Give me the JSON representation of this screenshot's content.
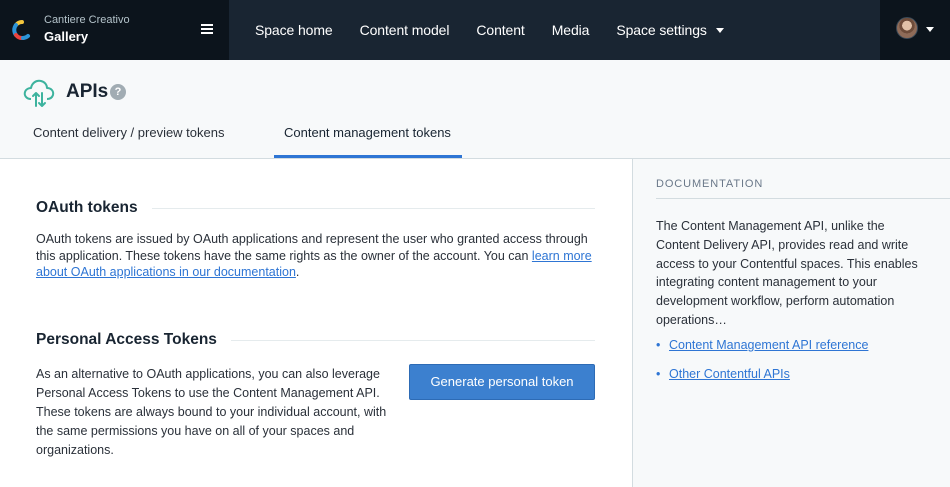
{
  "topbar": {
    "space_org": "Cantiere Creativo",
    "space_name": "Gallery",
    "nav": [
      {
        "label": "Space home"
      },
      {
        "label": "Content model"
      },
      {
        "label": "Content"
      },
      {
        "label": "Media"
      },
      {
        "label": "Space settings"
      }
    ],
    "icons": {
      "logo": "contentful-logo-icon",
      "menu": "hamburger-menu-icon",
      "account_caret": "caret-down-icon"
    }
  },
  "page": {
    "title": "APIs",
    "help_glyph": "?",
    "icon": "cloud-sync-icon",
    "tabs": [
      {
        "label": "Content delivery / preview tokens",
        "active": false
      },
      {
        "label": "Content management tokens",
        "active": true
      }
    ]
  },
  "oauth": {
    "title": "OAuth tokens",
    "text": "OAuth tokens are issued by OAuth applications and represent the user who granted access through this application. These tokens have the same rights as the owner of the account. You can ",
    "link": "learn more about OAuth applications in our documentation",
    "suffix": "."
  },
  "pat": {
    "title": "Personal Access Tokens",
    "text": "As an alternative to OAuth applications, you can also leverage Personal Access Tokens to use the Content Management API. These tokens are always bound to your individual account, with the same permissions you have on all of your spaces and organizations.",
    "button": "Generate personal token"
  },
  "sidebar": {
    "heading": "DOCUMENTATION",
    "text": "The Content Management API, unlike the Content Delivery API, provides read and write access to your Contentful spaces. This enables integrating content management to your development workflow, perform automation operations…",
    "links": [
      {
        "label": "Content Management API reference"
      },
      {
        "label": "Other Contentful APIs"
      }
    ],
    "bullet": "•"
  },
  "colors": {
    "topbar": "#192532",
    "accent": "#2e75d4",
    "button": "#3c80cf"
  }
}
